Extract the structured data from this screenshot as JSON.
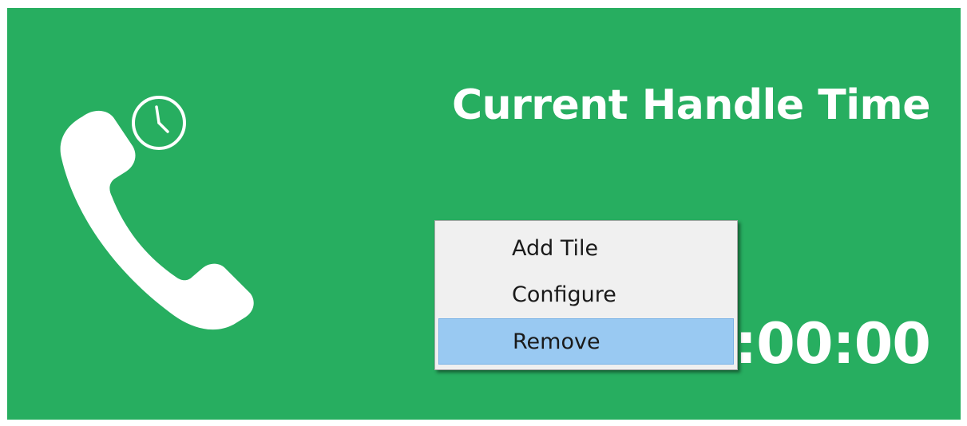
{
  "tile": {
    "title": "Current Handle Time",
    "timer_value": "0:00:00",
    "background_color": "#27ae60",
    "icon": "phone-clock-icon"
  },
  "context_menu": {
    "items": [
      {
        "label": "Add Tile",
        "highlighted": false
      },
      {
        "label": "Configure",
        "highlighted": false
      },
      {
        "label": "Remove",
        "highlighted": true
      }
    ],
    "highlight_color": "#99c9f2"
  }
}
